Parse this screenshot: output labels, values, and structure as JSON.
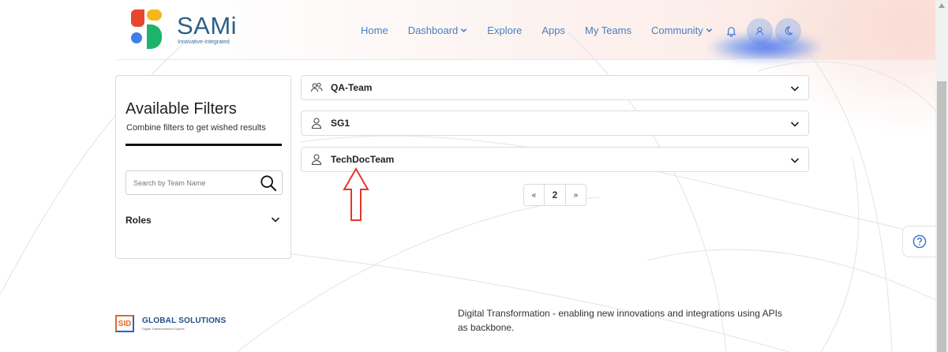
{
  "brand": {
    "name": "SAMi",
    "tagline": "Innovative-Integrated"
  },
  "nav": {
    "items": [
      {
        "label": "Home",
        "has_dropdown": false
      },
      {
        "label": "Dashboard",
        "has_dropdown": true
      },
      {
        "label": "Explore",
        "has_dropdown": false
      },
      {
        "label": "Apps",
        "has_dropdown": false
      },
      {
        "label": "My Teams",
        "has_dropdown": false
      },
      {
        "label": "Community",
        "has_dropdown": true
      }
    ],
    "icons": [
      "bell-icon",
      "user-icon",
      "moon-icon"
    ]
  },
  "filters": {
    "title": "Available Filters",
    "subtitle": "Combine filters to get wished results",
    "search_placeholder": "Search by Team Name",
    "search_value": "",
    "roles_label": "Roles"
  },
  "teams": [
    {
      "name": "QA-Team",
      "icon": "users-icon"
    },
    {
      "name": "SG1",
      "icon": "user-icon"
    },
    {
      "name": "TechDocTeam",
      "icon": "user-icon"
    }
  ],
  "pagination": {
    "prev": "«",
    "current": "2",
    "next": "»"
  },
  "footer": {
    "company_mark": "SID",
    "company_name": "GLOBAL SOLUTIONS",
    "company_tagline": "Digital Transformation Experts",
    "description": "Digital Transformation - enabling new innovations and integrations using APIs as backbone."
  },
  "colors": {
    "nav_link": "#4a7fc0",
    "brand_text": "#2a5f88",
    "annotation_arrow": "#e8352b"
  }
}
